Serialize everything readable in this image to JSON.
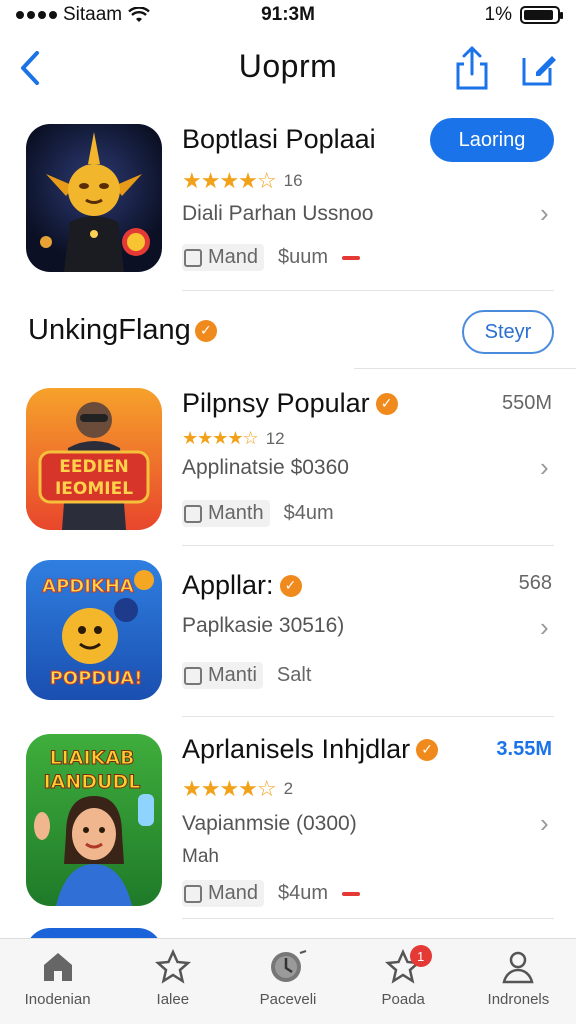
{
  "status": {
    "carrier": "Sitaam",
    "time": "91:3M",
    "battery_text": "1%",
    "battery_level": 0.9
  },
  "nav": {
    "title": "Uoprm"
  },
  "featured": {
    "title": "Boptlasi Poplaai",
    "button": "Laoring",
    "rating_count": "16",
    "subtitle": "Diali  Parhan Ussnoo",
    "tag": "Mand",
    "price": "$uum"
  },
  "section": {
    "title": "UnkingFlang",
    "button": "Steyr"
  },
  "apps": [
    {
      "title": "Pilpnsy Popular",
      "size": "550M",
      "rating_count": "12",
      "subtitle": "Applinatsie $0360",
      "tag": "Manth",
      "price": "$4um",
      "icon_text_top": "EEDIEN",
      "icon_text_bottom": "IEOMIEL"
    },
    {
      "title": "Appllar:",
      "size": "568",
      "subtitle": "Paplkasie 30516)",
      "tag": "Manti",
      "price": "Salt",
      "icon_text_top": "APDIKHA",
      "icon_text_bottom": "POPDUA!"
    },
    {
      "title": "Aprlanisels Inhjdlar",
      "size": "3.55M",
      "rating_count": "2",
      "subtitle": "Vapianmsie (0300)",
      "extra": "Mah",
      "tag": "Mand",
      "price": "$4um",
      "icon_text_top": "LIAIKAB",
      "icon_text_bottom": "IANDUDL"
    }
  ],
  "tabs": [
    {
      "label": "Inodenian",
      "icon": "home-icon"
    },
    {
      "label": "Ialee",
      "icon": "star-outline-icon"
    },
    {
      "label": "Paceveli",
      "icon": "compass-icon"
    },
    {
      "label": "Poada",
      "icon": "star-icon",
      "badge": "1"
    },
    {
      "label": "Indronels",
      "icon": "person-icon"
    }
  ],
  "colors": {
    "accent": "#1a73e8",
    "star": "#f2a11a",
    "badge": "#f08a1c",
    "notification": "#e53935"
  }
}
